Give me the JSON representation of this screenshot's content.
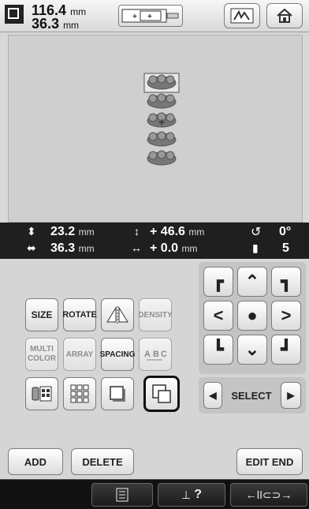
{
  "toolbar": {
    "width_value": "116.4",
    "height_value": "36.3",
    "unit": "mm",
    "icons": [
      "embroidery-size-icon",
      "frame-icon",
      "display-icon",
      "home-icon"
    ]
  },
  "status": {
    "height_value": "23.2",
    "width_value": "36.3",
    "unit": "mm",
    "pos_y_value": "+ 46.6",
    "pos_x_value": "+ 0.0",
    "rotation_value": "0°",
    "color_count": "5"
  },
  "buttons": {
    "size": "SIZE",
    "rotate": "ROTATE",
    "density": "DENSITY",
    "multi_color": "MULTI COLOR",
    "array": "ARRAY",
    "spacing": "SPACING",
    "select": "SELECT",
    "add": "ADD",
    "delete": "DELETE",
    "edit_end": "EDIT END"
  },
  "bottom": {
    "help_text": "?"
  },
  "colors": {
    "panel": "#d5d5d5",
    "status": "#1f1f1f",
    "bottom": "#111111",
    "highlight": "#111111"
  }
}
